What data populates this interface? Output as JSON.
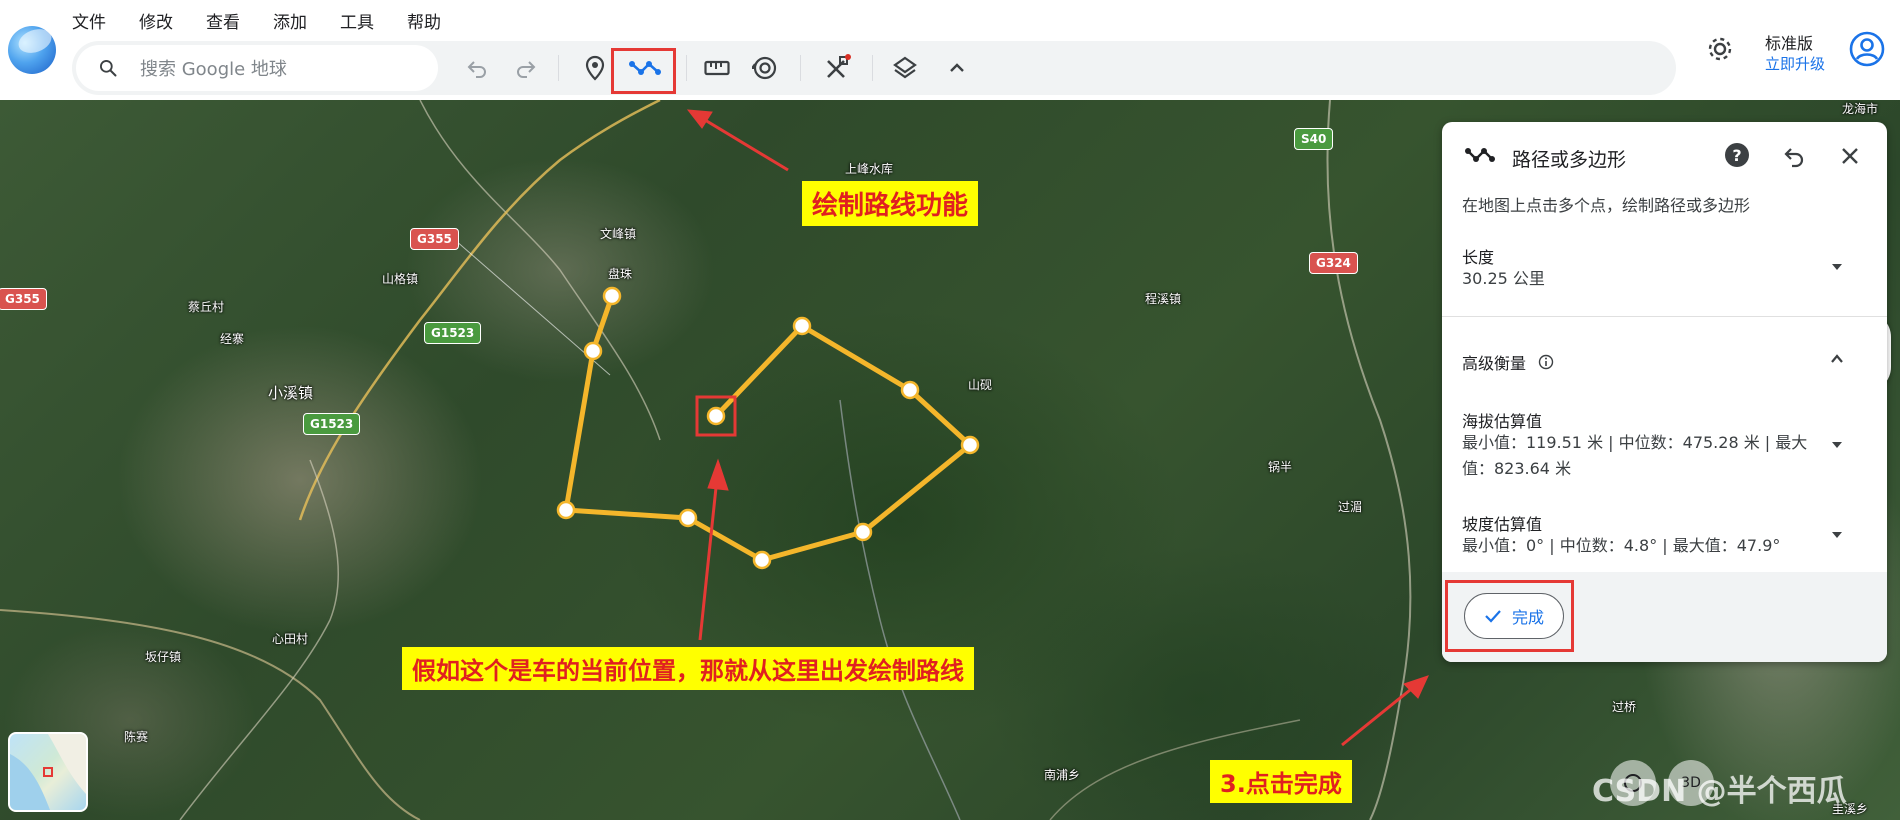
{
  "app": {
    "menu": [
      "文件",
      "修改",
      "查看",
      "添加",
      "工具",
      "帮助"
    ],
    "search": {
      "placeholder": "搜索 Google 地球"
    },
    "edition": "标准版",
    "upgrade": "立即升级"
  },
  "map": {
    "labels": {
      "shangfeng": "上峰水库",
      "wenfeng": "文峰镇",
      "panzhu": "盘珠",
      "shange": "山格镇",
      "caiqiu": "蔡丘村",
      "jingzhai": "经寨",
      "xiaoxi": "小溪镇",
      "chengxi": "程溪镇",
      "shanlao": "山砚",
      "xiban": "锅半",
      "guoshui": "过湄",
      "xintian": "心田村",
      "banzai": "坂仔镇",
      "chensai": "陈赛",
      "nanpu": "南浦乡",
      "guoqiao": "过桥",
      "longhai": "龙海市",
      "guibian": "圭溪乡"
    },
    "shields": {
      "g355_a": "G355",
      "g355_b": "G355",
      "g1523_a": "G1523",
      "g1523_b": "G1523",
      "s40": "S40",
      "g324": "G324"
    },
    "callouts": {
      "draw_route": "绘制路线功能",
      "current_pos": "假如这个是车的当前位置，那就从这里出发绘制路线",
      "click_done": "3.点击完成"
    },
    "watermark": "CSDN @半个西瓜"
  },
  "panel": {
    "title": "路径或多边形",
    "subtitle": "在地图上点击多个点，绘制路径或多边形",
    "length_label": "长度",
    "length_value": "30.25 公里",
    "advanced_label": "高级衡量",
    "elevation_label": "海拔估算值",
    "elevation_value": "最小值：119.51 米 | 中位数：475.28 米 | 最大值：823.64 米",
    "slope_label": "坡度估算值",
    "slope_value": "最小值：0° | 中位数：4.8° | 最大值：47.9°",
    "done_label": "完成"
  },
  "colors": {
    "route": "#f4b62b",
    "accent": "#1a73e8",
    "annotation_red": "#e53935",
    "callout_bg": "#ffff00"
  },
  "icons": [
    "search-icon",
    "undo-icon",
    "redo-icon",
    "placemark-icon",
    "path-icon",
    "ruler-icon",
    "history-icon",
    "tools-icon",
    "layers-icon",
    "chevron-up-icon",
    "settings-icon",
    "account-icon",
    "help-icon",
    "close-icon",
    "check-icon",
    "info-icon",
    "chevron-down-icon",
    "compass-icon"
  ]
}
